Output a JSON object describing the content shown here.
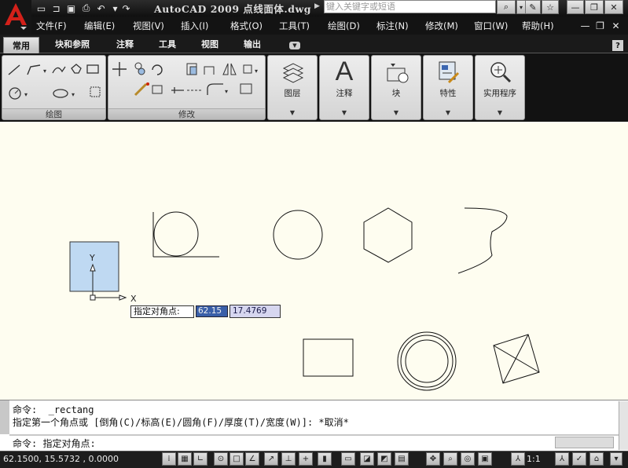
{
  "window": {
    "title": "AutoCAD 2009",
    "file": "点线面体.dwg",
    "search_placeholder": "键入关键字或短语"
  },
  "menus": [
    "文件(F)",
    "编辑(E)",
    "视图(V)",
    "插入(I)",
    "格式(O)",
    "工具(T)",
    "绘图(D)",
    "标注(N)",
    "修改(M)",
    "窗口(W)",
    "帮助(H)"
  ],
  "tabs": {
    "active": "常用",
    "others": [
      "块和参照",
      "注释",
      "工具",
      "视图",
      "输出"
    ]
  },
  "panels": {
    "draw": "绘图",
    "modify": "修改",
    "big": [
      "图层",
      "注释",
      "块",
      "特性",
      "实用程序"
    ]
  },
  "ucs": {
    "x": "X",
    "y": "Y"
  },
  "dynamic_input": {
    "prompt": "指定对角点:",
    "x_value": "62.15",
    "y_value": "17.4769"
  },
  "command": {
    "line1": "命令:  _rectang",
    "line2": "指定第一个角点或 [倒角(C)/标高(E)/圆角(F)/厚度(T)/宽度(W)]: *取消*",
    "current": "命令: 指定对角点:"
  },
  "status": {
    "coords": "62.1500,   15.5732 , 0.0000",
    "scale": "1:1"
  },
  "icons": [
    "app-logo",
    "new-icon",
    "open-icon",
    "save-icon",
    "print-icon",
    "undo-icon",
    "redo-icon",
    "search-icon",
    "star-icon",
    "help-icon",
    "line-icon",
    "polyline-icon",
    "circle-icon",
    "arc-icon",
    "move-icon",
    "copy-icon",
    "rotate-icon",
    "mirror-icon",
    "layers-icon",
    "annotation-icon",
    "block-icon",
    "properties-icon",
    "utilities-icon"
  ],
  "colors": {
    "canvas": "#fefdf0",
    "chrome": "#121212",
    "ucs_fill": "#bfd9f2",
    "dyn_value": "#3a5fa8"
  }
}
